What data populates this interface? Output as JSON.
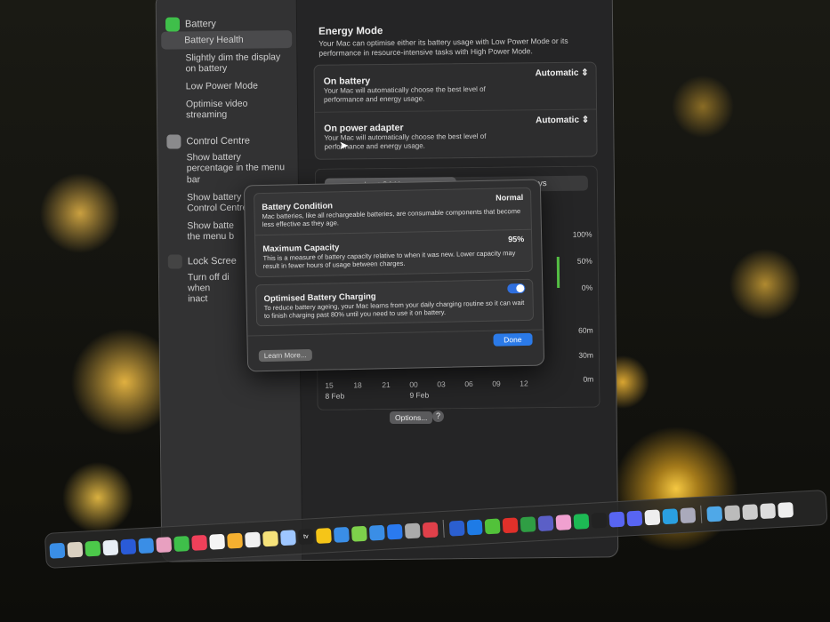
{
  "sidebar": {
    "battery": {
      "label": "Battery",
      "items": [
        "Battery Health",
        "Slightly dim the display on battery",
        "Low Power Mode",
        "Optimise video streaming"
      ]
    },
    "control_centre": {
      "label": "Control Centre",
      "items": [
        "Show battery percentage in the menu bar",
        "Show battery status in Control Centre",
        "Show batte the menu b"
      ]
    },
    "lock_screen": {
      "label": "Lock Scree",
      "items": [
        "Turn off di when inact"
      ]
    }
  },
  "energy": {
    "title": "Energy Mode",
    "description": "Your Mac can optimise either its battery usage with Low Power Mode or its performance in resource-intensive tasks with High Power Mode.",
    "rows": [
      {
        "title": "On battery",
        "description": "Your Mac will automatically choose the best level of performance and energy usage.",
        "value": "Automatic"
      },
      {
        "title": "On power adapter",
        "description": "Your Mac will automatically choose the best level of performance and energy usage.",
        "value": "Automatic"
      }
    ]
  },
  "usage": {
    "tabs": [
      "Last 24 Hours",
      "Last 10 Days"
    ],
    "selected": 0,
    "y_level": [
      "100%",
      "50%",
      "0%"
    ],
    "y_time": [
      "60m",
      "30m",
      "0m"
    ],
    "x_ticks": [
      "15",
      "18",
      "21",
      "00",
      "03",
      "06",
      "09",
      "12"
    ],
    "dates": [
      "8 Feb",
      "9 Feb"
    ],
    "options_label": "Options...",
    "help_label": "?"
  },
  "dialog": {
    "condition": {
      "title": "Battery Condition",
      "description": "Mac batteries, like all rechargeable batteries, are consumable components that become less effective as they age.",
      "value": "Normal"
    },
    "capacity": {
      "title": "Maximum Capacity",
      "description": "This is a measure of battery capacity relative to when it was new. Lower capacity may result in fewer hours of usage between charges.",
      "value": "95%"
    },
    "optimised": {
      "title": "Optimised Battery Charging",
      "description": "To reduce battery ageing, your Mac learns from your daily charging routine so it can wait to finish charging past 80% until you need to use it on battery.",
      "enabled": true
    },
    "learn_more": "Learn More...",
    "done": "Done"
  },
  "dock": {
    "tv_label": "tv",
    "icons": [
      "#3a8ee6",
      "#d9d0c0",
      "#4cc94a",
      "#e8eef5",
      "#2a5bd7",
      "#3a8ee6",
      "#e8a0c0",
      "#3fbf4a",
      "#f0405a",
      "#f5f5f5",
      "#f5b030",
      "#f0f0f0",
      "#f6e27a",
      "#9ec6ff",
      "#222",
      "#f5c518",
      "#3a8ee6",
      "#7ed04b",
      "#3a8ee6",
      "#2a7af0",
      "#aaa",
      "#e0404a",
      "|",
      "#2b5fd0",
      "#1e7be6",
      "#52c23a",
      "#e0302a",
      "#2f9e44",
      "#5b5fc7",
      "#f0a0d0",
      "#1db954",
      "#222",
      "#5865f2",
      "#5865f2",
      "#eee",
      "#2aa0e0",
      "#aab",
      "|",
      "#4fa8e8",
      "#bbb",
      "#ccc",
      "#ddd",
      "#eee"
    ]
  }
}
